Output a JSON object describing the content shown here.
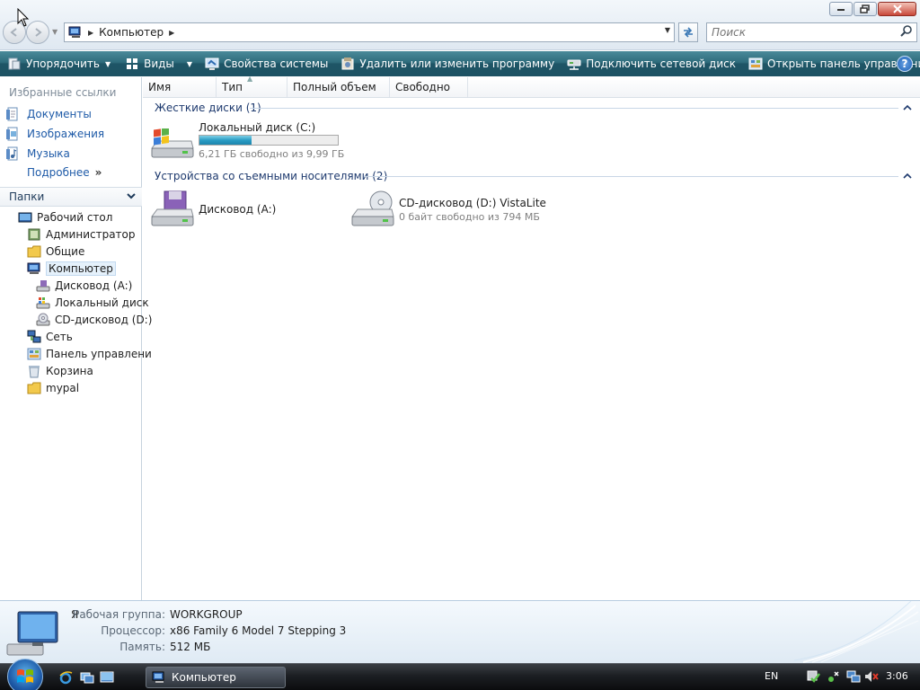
{
  "window": {
    "address": {
      "segment": "Компьютер"
    },
    "search": {
      "placeholder": "Поиск"
    }
  },
  "toolbar": {
    "organize": "Упорядочить",
    "views": "Виды",
    "system_properties": "Свойства системы",
    "uninstall": "Удалить или изменить программу",
    "map_drive": "Подключить сетевой диск",
    "control_panel": "Открыть панель управления"
  },
  "favorites": {
    "title": "Избранные ссылки",
    "items": [
      "Документы",
      "Изображения",
      "Музыка"
    ],
    "more": "Подробнее",
    "more_glyph": "»"
  },
  "folders": {
    "header": "Папки",
    "tree": [
      "Рабочий стол",
      "Администратор",
      "Общие",
      "Компьютер",
      "Дисковод (A:)",
      "Локальный диск",
      "CD-дисковод (D:)",
      "Сеть",
      "Панель управлени",
      "Корзина",
      "mypal"
    ]
  },
  "columns": [
    "Имя",
    "Тип",
    "Полный объем",
    "Свободно"
  ],
  "groups": {
    "hard_disks": {
      "title": "Жесткие диски (1)",
      "drives": [
        {
          "name": "Локальный диск (C:)",
          "info": "6,21 ГБ свободно из 9,99 ГБ",
          "used_fraction": 0.378
        }
      ]
    },
    "removable": {
      "title": "Устройства со съемными носителями (2)",
      "drives": [
        {
          "name": "Дисковод (A:)"
        },
        {
          "name": "CD-дисковод (D:) VistaLite",
          "info": "0 байт свободно из 794 МБ"
        }
      ]
    }
  },
  "details": {
    "name_fragment": "Я",
    "rows": [
      {
        "label": "Рабочая группа:",
        "value": "WORKGROUP"
      },
      {
        "label": "Процессор:",
        "value": "x86 Family 6 Model 7 Stepping 3"
      },
      {
        "label": "Память:",
        "value": "512 МБ"
      }
    ]
  },
  "taskbar": {
    "task_button": "Компьютер",
    "language": "EN",
    "clock": "3:06"
  },
  "colors": {
    "toolbar": "#1d5263",
    "link": "#1f5ba8",
    "group_header": "#1e3a6e",
    "usage_fill": "#2a9cc4"
  }
}
